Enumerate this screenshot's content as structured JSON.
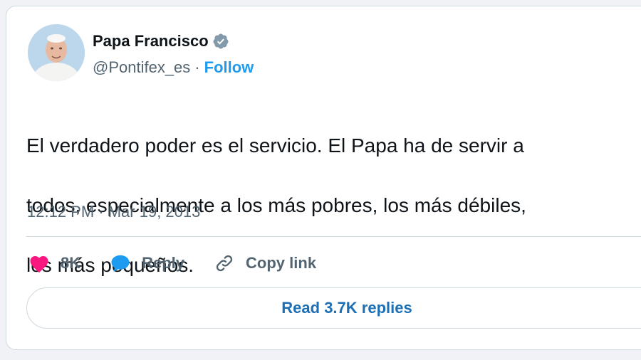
{
  "author": {
    "name": "Papa Francisco",
    "handle": "@Pontifex_es",
    "separator": "·",
    "follow_label": "Follow",
    "verified_icon": "verified-badge-icon"
  },
  "tweet": {
    "text_line1": "El verdadero poder es el servicio. El Papa ha de servir a",
    "text_line2": "todos, especialmente a los más pobres, los más débiles,",
    "text_line3": "los más pequeños.",
    "timestamp": "12:12 PM · Mar 19, 2013"
  },
  "actions": {
    "like_count": "8K",
    "reply_label": "Reply",
    "copy_link_label": "Copy link"
  },
  "replies_button": {
    "label": "Read 3.7K replies"
  },
  "colors": {
    "accent": "#1d9bf0",
    "like": "#f91880",
    "muted": "#536471",
    "border": "#cfd9de"
  }
}
